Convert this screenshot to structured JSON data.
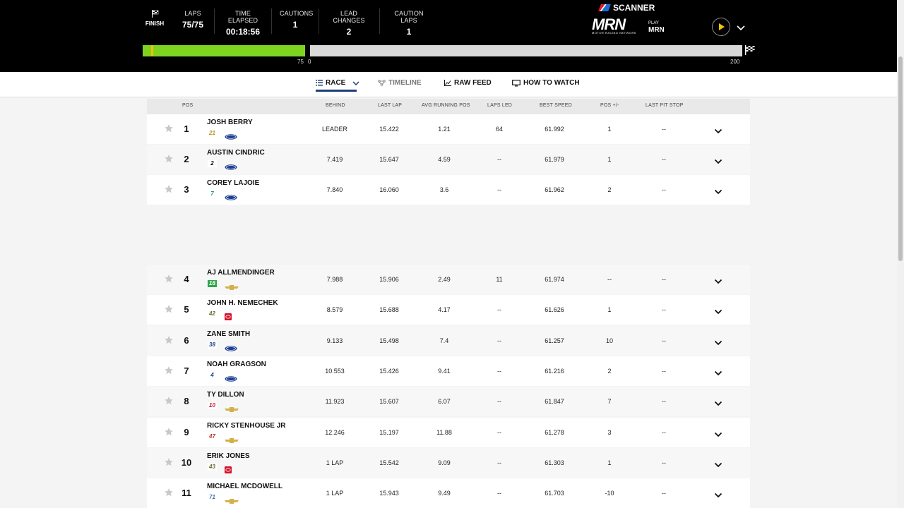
{
  "header": {
    "finish_label": "FINISH",
    "stats": [
      {
        "label": "LAPS",
        "value": "75/75"
      },
      {
        "label": "TIME ELAPSED",
        "value": "00:18:56"
      },
      {
        "label": "CAUTIONS",
        "value": "1"
      },
      {
        "label": "LEAD CHANGES",
        "value": "2"
      },
      {
        "label": "CAUTION LAPS",
        "value": "1"
      }
    ],
    "scanner_label": "SCANNER",
    "mrn_logo": "MRN",
    "mrn_tagline": "MOTOR RACING NETWORK",
    "play_small": "PLAY",
    "play_big": "MRN",
    "progress": {
      "stage_complete_fraction": 1.0,
      "label_stage_end": "75",
      "label_start": "0",
      "label_end": "200",
      "green_color": "#7ed321"
    }
  },
  "tabs": [
    {
      "label": "RACE",
      "icon": "list-icon",
      "active": true
    },
    {
      "label": "TIMELINE",
      "icon": "timeline-icon",
      "active": false
    },
    {
      "label": "RAW FEED",
      "icon": "chart-line-icon",
      "active": false
    },
    {
      "label": "HOW TO WATCH",
      "icon": "monitor-icon",
      "active": false
    }
  ],
  "table": {
    "columns": [
      "POS",
      "BEHIND",
      "LAST LAP",
      "AVG RUNNING POS",
      "LAPS LED",
      "BEST SPEED",
      "POS +/-",
      "LAST PIT STOP"
    ],
    "rows": [
      {
        "pos": "1",
        "name": "JOSH BERRY",
        "car": "21",
        "make": "ford",
        "behind": "LEADER",
        "last_lap": "15.422",
        "avg_pos": "1.21",
        "laps_led": "64",
        "best_speed": "61.992",
        "pos_change": "1",
        "last_pit": "--"
      },
      {
        "pos": "2",
        "name": "AUSTIN CINDRIC",
        "car": "2",
        "make": "ford",
        "behind": "7.419",
        "last_lap": "15.647",
        "avg_pos": "4.59",
        "laps_led": "--",
        "best_speed": "61.979",
        "pos_change": "1",
        "last_pit": "--"
      },
      {
        "pos": "3",
        "name": "COREY LAJOIE",
        "car": "7",
        "make": "ford",
        "behind": "7.840",
        "last_lap": "16.060",
        "avg_pos": "3.6",
        "laps_led": "--",
        "best_speed": "61.962",
        "pos_change": "2",
        "last_pit": "--"
      },
      {
        "pos": "4",
        "name": "AJ ALLMENDINGER",
        "car": "16",
        "make": "chevrolet",
        "behind": "7.988",
        "last_lap": "15.906",
        "avg_pos": "2.49",
        "laps_led": "11",
        "best_speed": "61.974",
        "pos_change": "--",
        "last_pit": "--"
      },
      {
        "pos": "5",
        "name": "JOHN H. NEMECHEK",
        "car": "42",
        "make": "toyota",
        "behind": "8.579",
        "last_lap": "15.688",
        "avg_pos": "4.17",
        "laps_led": "--",
        "best_speed": "61.626",
        "pos_change": "1",
        "last_pit": "--"
      },
      {
        "pos": "6",
        "name": "ZANE SMITH",
        "car": "38",
        "make": "ford",
        "behind": "9.133",
        "last_lap": "15.498",
        "avg_pos": "7.4",
        "laps_led": "--",
        "best_speed": "61.257",
        "pos_change": "10",
        "last_pit": "--"
      },
      {
        "pos": "7",
        "name": "NOAH GRAGSON",
        "car": "4",
        "make": "ford",
        "behind": "10.553",
        "last_lap": "15.426",
        "avg_pos": "9.41",
        "laps_led": "--",
        "best_speed": "61.216",
        "pos_change": "2",
        "last_pit": "--"
      },
      {
        "pos": "8",
        "name": "TY DILLON",
        "car": "10",
        "make": "chevrolet",
        "behind": "11.923",
        "last_lap": "15.607",
        "avg_pos": "6.07",
        "laps_led": "--",
        "best_speed": "61.847",
        "pos_change": "7",
        "last_pit": "--"
      },
      {
        "pos": "9",
        "name": "RICKY STENHOUSE JR",
        "car": "47",
        "make": "chevrolet",
        "behind": "12.246",
        "last_lap": "15.197",
        "avg_pos": "11.88",
        "laps_led": "--",
        "best_speed": "61.278",
        "pos_change": "3",
        "last_pit": "--"
      },
      {
        "pos": "10",
        "name": "ERIK JONES",
        "car": "43",
        "make": "toyota",
        "behind": "1 LAP",
        "last_lap": "15.542",
        "avg_pos": "9.09",
        "laps_led": "--",
        "best_speed": "61.303",
        "pos_change": "1",
        "last_pit": "--"
      },
      {
        "pos": "11",
        "name": "MICHAEL MCDOWELL",
        "car": "71",
        "make": "chevrolet",
        "behind": "1 LAP",
        "last_lap": "15.943",
        "avg_pos": "9.49",
        "laps_led": "--",
        "best_speed": "61.703",
        "pos_change": "-10",
        "last_pit": "--"
      }
    ]
  },
  "colors": {
    "header_bg": "#000000",
    "accent_blue": "#1d3d7a",
    "play_yellow": "#f2c200",
    "ford_blue": "#1c3f94",
    "toyota_red": "#d3122a",
    "chevy_gold": "#d4b04a"
  },
  "car_colors": {
    "21": {
      "bg": "#ffffff",
      "fg": "#b8971c"
    },
    "2": {
      "bg": "#ffffff",
      "fg": "#111111"
    },
    "7": {
      "bg": "#ffffff",
      "fg": "#1aa36b"
    },
    "16": {
      "bg": "#2ea84a",
      "fg": "#ffffff"
    },
    "42": {
      "bg": "#ffffff",
      "fg": "#6b6b2a"
    },
    "38": {
      "bg": "#ffffff",
      "fg": "#1c3f94"
    },
    "4": {
      "bg": "#ffffff",
      "fg": "#1c3f94"
    },
    "10": {
      "bg": "#ffffff",
      "fg": "#d3122a"
    },
    "47": {
      "bg": "#ffffff",
      "fg": "#c0392b"
    },
    "43": {
      "bg": "#ffffff",
      "fg": "#6b6b2a"
    },
    "71": {
      "bg": "#ffffff",
      "fg": "#4a6fb5"
    }
  }
}
